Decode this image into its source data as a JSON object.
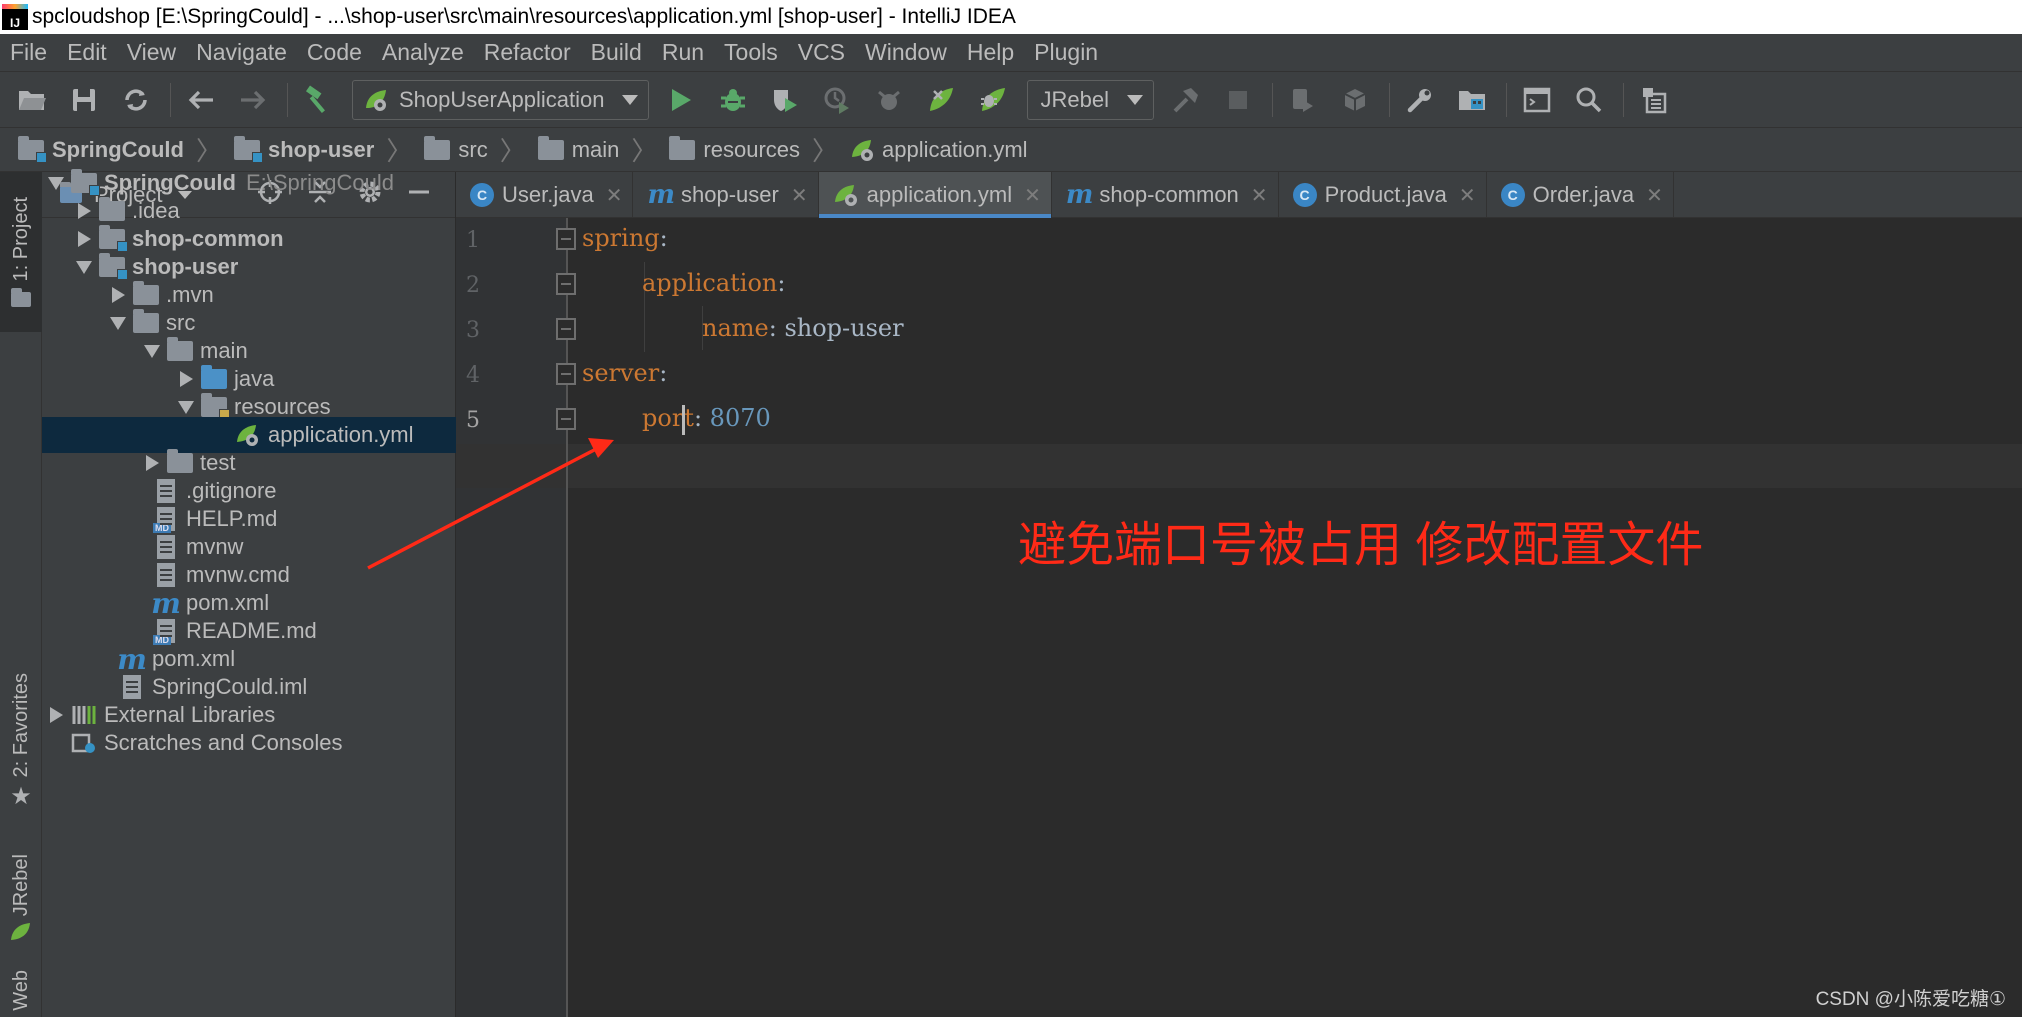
{
  "window": {
    "title": "spcloudshop [E:\\SpringCould] - ...\\shop-user\\src\\main\\resources\\application.yml [shop-user] - IntelliJ IDEA",
    "app_icon_text": "IJ"
  },
  "menu": [
    "File",
    "Edit",
    "View",
    "Navigate",
    "Code",
    "Analyze",
    "Refactor",
    "Build",
    "Run",
    "Tools",
    "VCS",
    "Window",
    "Help",
    "Plugin"
  ],
  "toolbar": {
    "run_config": "ShopUserApplication",
    "jrebel_config": "JRebel"
  },
  "breadcrumb": [
    "SpringCould",
    "shop-user",
    "src",
    "main",
    "resources",
    "application.yml"
  ],
  "side_strip": {
    "project_tab": "1: Project",
    "favorites_tab": "2: Favorites",
    "jrebel_tab": "JRebel",
    "web_tab": "Web"
  },
  "project_panel": {
    "title": "Project",
    "tree": [
      {
        "label": "SpringCould",
        "hint": "E:\\SpringCould",
        "icon": "module-folder-icon"
      },
      {
        "label": ".idea",
        "icon": "folder-icon"
      },
      {
        "label": "shop-common",
        "icon": "module-folder-icon"
      },
      {
        "label": "shop-user",
        "icon": "module-folder-icon"
      },
      {
        "label": ".mvn",
        "icon": "folder-icon"
      },
      {
        "label": "src",
        "icon": "folder-icon"
      },
      {
        "label": "main",
        "icon": "folder-icon"
      },
      {
        "label": "java",
        "icon": "source-folder-icon"
      },
      {
        "label": "resources",
        "icon": "resources-folder-icon"
      },
      {
        "label": "application.yml",
        "icon": "spring-yml-icon"
      },
      {
        "label": "test",
        "icon": "folder-icon"
      },
      {
        "label": ".gitignore",
        "icon": "text-file-icon"
      },
      {
        "label": "HELP.md",
        "icon": "markdown-file-icon"
      },
      {
        "label": "mvnw",
        "icon": "text-file-icon"
      },
      {
        "label": "mvnw.cmd",
        "icon": "text-file-icon"
      },
      {
        "label": "pom.xml",
        "icon": "maven-icon"
      },
      {
        "label": "README.md",
        "icon": "markdown-file-icon"
      },
      {
        "label": "pom.xml",
        "icon": "maven-icon"
      },
      {
        "label": "SpringCould.iml",
        "icon": "iml-file-icon"
      },
      {
        "label": "External Libraries",
        "icon": "libraries-icon"
      },
      {
        "label": "Scratches and Consoles",
        "icon": "scratches-icon"
      }
    ]
  },
  "tabs": [
    {
      "label": "User.java",
      "icon": "class-icon",
      "active": false
    },
    {
      "label": "shop-user",
      "icon": "maven-icon",
      "active": false
    },
    {
      "label": "application.yml",
      "icon": "spring-yml-icon",
      "active": true
    },
    {
      "label": "shop-common",
      "icon": "maven-icon",
      "active": false
    },
    {
      "label": "Product.java",
      "icon": "class-icon",
      "active": false
    },
    {
      "label": "Order.java",
      "icon": "class-icon",
      "active": false
    }
  ],
  "editor": {
    "line_numbers": [
      "1",
      "2",
      "3",
      "4",
      "5"
    ],
    "lines": [
      {
        "key": "spring",
        "sep": ":",
        "value": ""
      },
      {
        "key": "application",
        "sep": ":",
        "value": ""
      },
      {
        "key": "name",
        "sep": ": ",
        "value": "shop-user"
      },
      {
        "key": "server",
        "sep": ":",
        "value": ""
      },
      {
        "key_a": "por",
        "key_b": "t",
        "sep": ": ",
        "value": "8070"
      }
    ],
    "current_line": 5
  },
  "annotation": {
    "text": "避免端口号被占用 修改配置文件",
    "color": "#ff2a17"
  },
  "watermark": "CSDN @小陈爱吃糖①",
  "colors": {
    "key": "#cc7832",
    "number": "#6897bb",
    "string": "#a9b7c6",
    "selection": "#0d293e",
    "accent": "#4a88c7"
  }
}
